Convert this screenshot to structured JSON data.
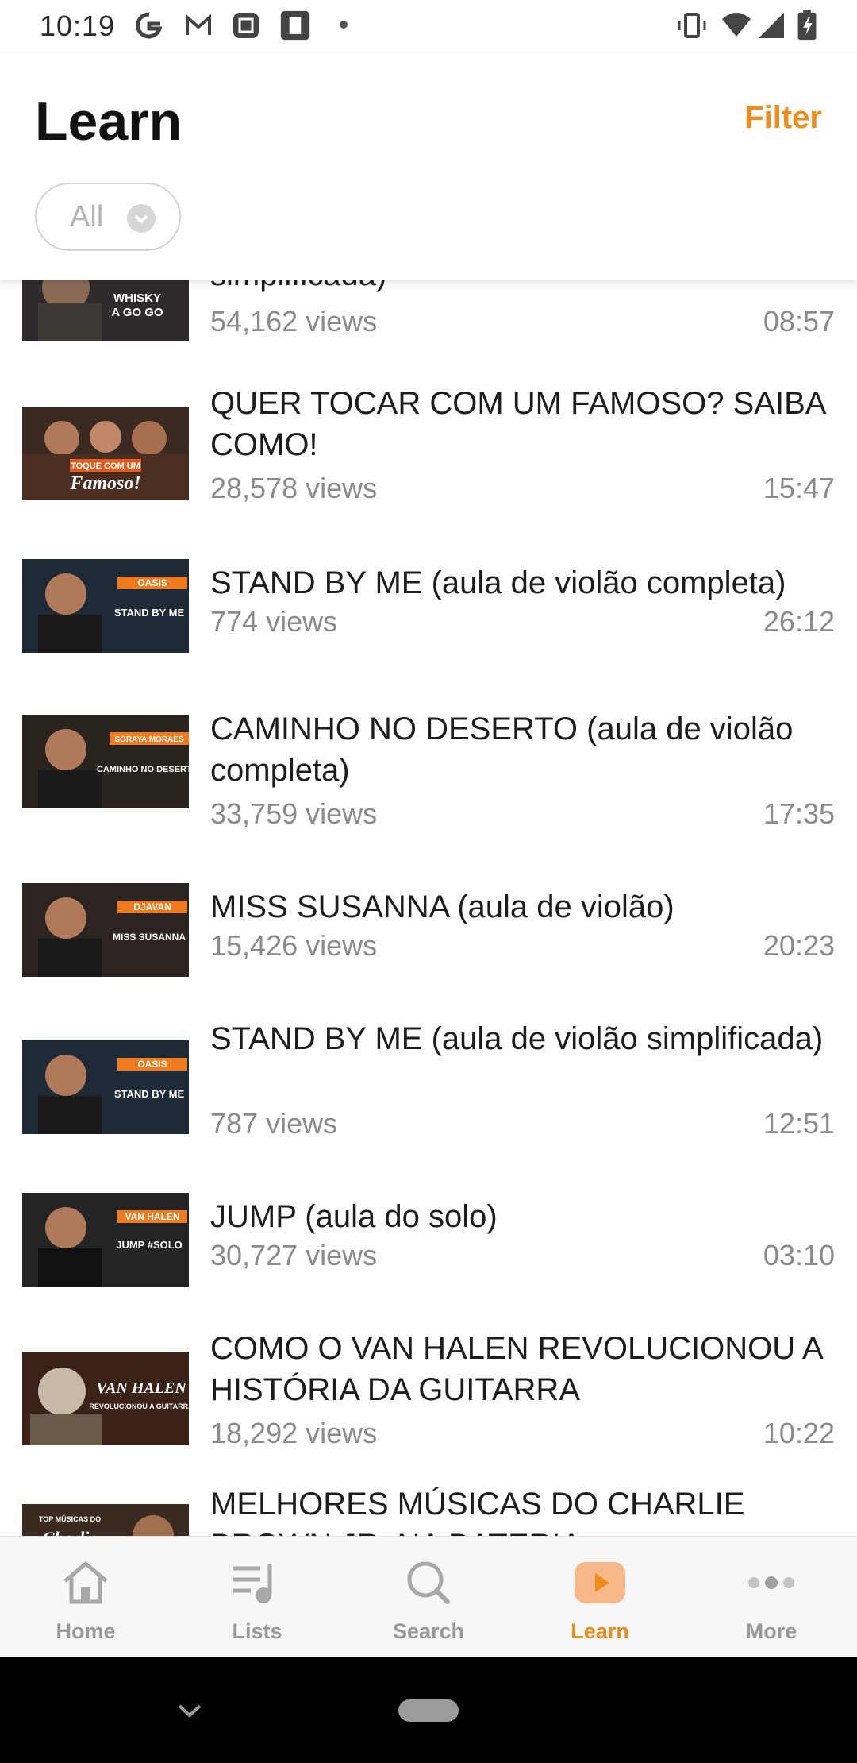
{
  "status_bar": {
    "time": "10:19"
  },
  "header": {
    "title": "Learn",
    "filter_label": "Filter",
    "chip_label": "All"
  },
  "videos": [
    {
      "title": "simplificada)",
      "views": "54,162 views",
      "duration": "08:57",
      "thumb_text": [
        "WHISKY",
        "A GO GO"
      ]
    },
    {
      "title": "QUER TOCAR COM UM FAMOSO? SAIBA COMO!",
      "views": "28,578 views",
      "duration": "15:47",
      "thumb_text": [
        "TOQUE COM UM",
        "Famoso!"
      ]
    },
    {
      "title": "STAND BY ME (aula de violão completa)",
      "views": "774 views",
      "duration": "26:12",
      "thumb_text": [
        "OASIS",
        "STAND BY ME"
      ]
    },
    {
      "title": "CAMINHO NO DESERTO (aula de violão completa)",
      "views": "33,759 views",
      "duration": "17:35",
      "thumb_text": [
        "SORAYA MORAES",
        "CAMINHO NO DESERTO"
      ]
    },
    {
      "title": "MISS SUSANNA (aula de violão)",
      "views": "15,426 views",
      "duration": "20:23",
      "thumb_text": [
        "DJAVAN",
        "MISS SUSANNA"
      ]
    },
    {
      "title": "STAND BY ME (aula de violão simplificada)",
      "views": "787 views",
      "duration": "12:51",
      "thumb_text": [
        "OASIS",
        "STAND BY ME"
      ]
    },
    {
      "title": "JUMP (aula do solo)",
      "views": "30,727 views",
      "duration": "03:10",
      "thumb_text": [
        "VAN HALEN",
        "JUMP #SOLO"
      ]
    },
    {
      "title": "COMO O VAN HALEN REVOLUCIONOU A HISTÓRIA DA GUITARRA",
      "views": "18,292 views",
      "duration": "10:22",
      "thumb_text": [
        "VAN HALEN",
        "REVOLUCIONOU A GUITARRA"
      ]
    },
    {
      "title": "MELHORES MÚSICAS DO CHARLIE BROWN JR. NA BATERIA",
      "views": "",
      "duration": "",
      "thumb_text": [
        "TOP MÚSICAS DO",
        "Charlie"
      ]
    }
  ],
  "bottom_nav": [
    {
      "label": "Home",
      "icon": "home-icon",
      "active": false
    },
    {
      "label": "Lists",
      "icon": "playlist-icon",
      "active": false
    },
    {
      "label": "Search",
      "icon": "search-icon",
      "active": false
    },
    {
      "label": "Learn",
      "icon": "play-icon",
      "active": true
    },
    {
      "label": "More",
      "icon": "more-icon",
      "active": false
    }
  ],
  "colors": {
    "accent": "#f08c1c",
    "muted": "#8b8b8b"
  }
}
